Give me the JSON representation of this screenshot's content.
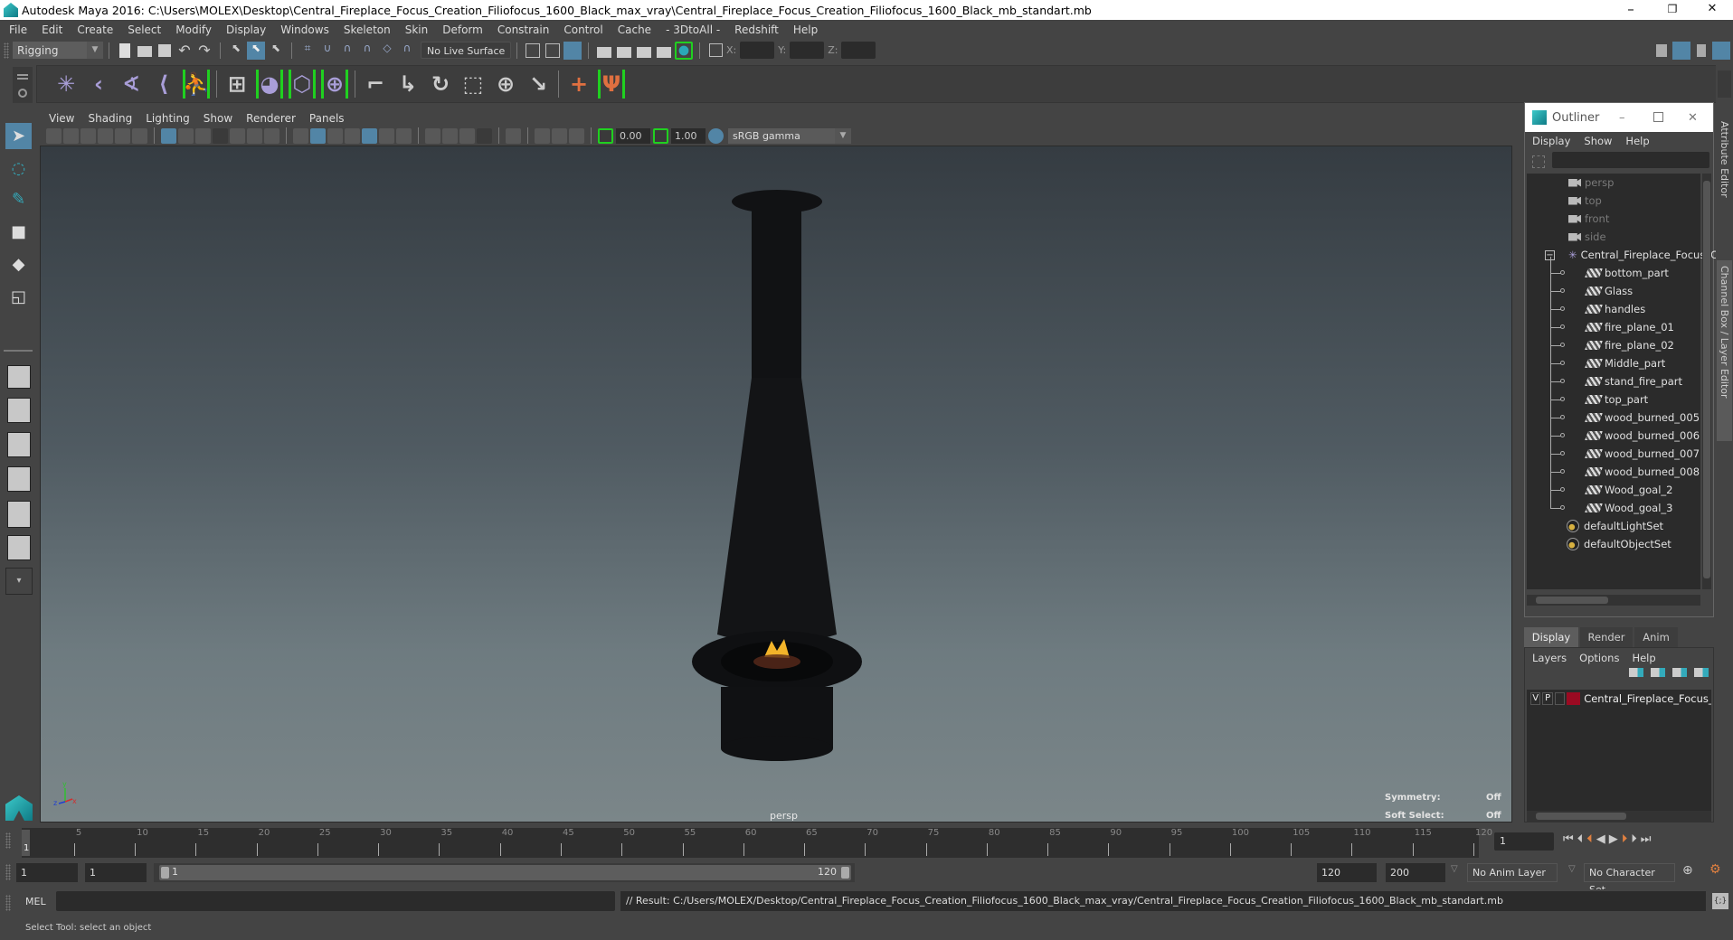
{
  "window": {
    "title": "Autodesk Maya 2016: C:\\Users\\MOLEX\\Desktop\\Central_Fireplace_Focus_Creation_Filiofocus_1600_Black_max_vray\\Central_Fireplace_Focus_Creation_Filiofocus_1600_Black_mb_standart.mb",
    "minimize": "–",
    "restore": "❐",
    "close": "✕"
  },
  "menubar": [
    "File",
    "Edit",
    "Create",
    "Select",
    "Modify",
    "Display",
    "Windows",
    "Skeleton",
    "Skin",
    "Deform",
    "Constrain",
    "Control",
    "Cache",
    "- 3DtoAll -",
    "Redshift",
    "Help"
  ],
  "statusline": {
    "menuset": "Rigging",
    "live_surface": "No Live Surface",
    "x_label": "X:",
    "y_label": "Y:",
    "z_label": "Z:"
  },
  "shelf": {
    "icons": [
      "joint-tool-icon",
      "insert-joint-icon",
      "mirror-joint-icon",
      "ik-handle-icon",
      "human-ik-icon",
      "create-lattice-icon",
      "smooth-bind-icon",
      "interactive-bind-icon",
      "paint-weights-icon",
      "parent-constraint-icon",
      "point-constraint-icon",
      "orient-constraint-icon",
      "scale-constraint-icon",
      "aim-constraint-icon",
      "pole-vector-constraint-icon",
      "locator-icon",
      "cluster-icon"
    ]
  },
  "viewport": {
    "menu": [
      "View",
      "Shading",
      "Lighting",
      "Show",
      "Renderer",
      "Panels"
    ],
    "near_value": "0.00",
    "far_value": "1.00",
    "color_space": "sRGB gamma",
    "camera_label": "persp",
    "hud": {
      "symmetry_label": "Symmetry:",
      "symmetry_value": "Off",
      "soft_select_label": "Soft Select:",
      "soft_select_value": "Off"
    },
    "axis": {
      "x": "x",
      "y": "y",
      "z": "z"
    },
    "colors": {
      "axis_x": "#d03030",
      "axis_y": "#30c030",
      "axis_z": "#2040d0"
    }
  },
  "right_tabs": [
    "Attribute Editor",
    "Channel Box / Layer Editor"
  ],
  "outliner": {
    "title": "Outliner",
    "menu": [
      "Display",
      "Show",
      "Help"
    ],
    "items": [
      {
        "label": "persp",
        "type": "camera"
      },
      {
        "label": "top",
        "type": "camera"
      },
      {
        "label": "front",
        "type": "camera"
      },
      {
        "label": "side",
        "type": "camera"
      },
      {
        "label": "Central_Fireplace_Focus_C",
        "type": "group",
        "expanded": true
      },
      {
        "label": "bottom_part",
        "type": "mesh"
      },
      {
        "label": "Glass",
        "type": "mesh"
      },
      {
        "label": "handles",
        "type": "mesh"
      },
      {
        "label": "fire_plane_01",
        "type": "mesh"
      },
      {
        "label": "fire_plane_02",
        "type": "mesh"
      },
      {
        "label": "Middle_part",
        "type": "mesh"
      },
      {
        "label": "stand_fire_part",
        "type": "mesh"
      },
      {
        "label": "top_part",
        "type": "mesh"
      },
      {
        "label": "wood_burned_005",
        "type": "mesh"
      },
      {
        "label": "wood_burned_006",
        "type": "mesh"
      },
      {
        "label": "wood_burned_007",
        "type": "mesh"
      },
      {
        "label": "wood_burned_008",
        "type": "mesh"
      },
      {
        "label": "Wood_goal_2",
        "type": "mesh"
      },
      {
        "label": "Wood_goal_3",
        "type": "mesh"
      },
      {
        "label": "defaultLightSet",
        "type": "set"
      },
      {
        "label": "defaultObjectSet",
        "type": "set"
      }
    ]
  },
  "layer_editor": {
    "tabs": [
      "Display",
      "Render",
      "Anim"
    ],
    "active_tab": "Display",
    "menu": [
      "Layers",
      "Options",
      "Help"
    ],
    "layers": [
      {
        "v": "V",
        "p": "P",
        "name": "Central_Fireplace_Focus_Cre",
        "color": "#9b0a22"
      }
    ]
  },
  "timeline": {
    "ticks": [
      "5",
      "10",
      "15",
      "20",
      "25",
      "30",
      "35",
      "40",
      "45",
      "50",
      "55",
      "60",
      "65",
      "70",
      "75",
      "80",
      "85",
      "90",
      "95",
      "100",
      "105",
      "110",
      "115",
      "120"
    ],
    "current_frame_marker": "1",
    "current_frame": "1"
  },
  "range": {
    "start": "1",
    "playback_start": "1",
    "slider_start": "1",
    "slider_end": "120",
    "playback_end": "120",
    "end": "200",
    "anim_layer": "No Anim Layer",
    "character_set": "No Character Set"
  },
  "command_line": {
    "language": "MEL",
    "input": "",
    "result": "// Result: C:/Users/MOLEX/Desktop/Central_Fireplace_Focus_Creation_Filiofocus_1600_Black_max_vray/Central_Fireplace_Focus_Creation_Filiofocus_1600_Black_mb_standart.mb"
  },
  "help_line": "Select Tool: select an object"
}
